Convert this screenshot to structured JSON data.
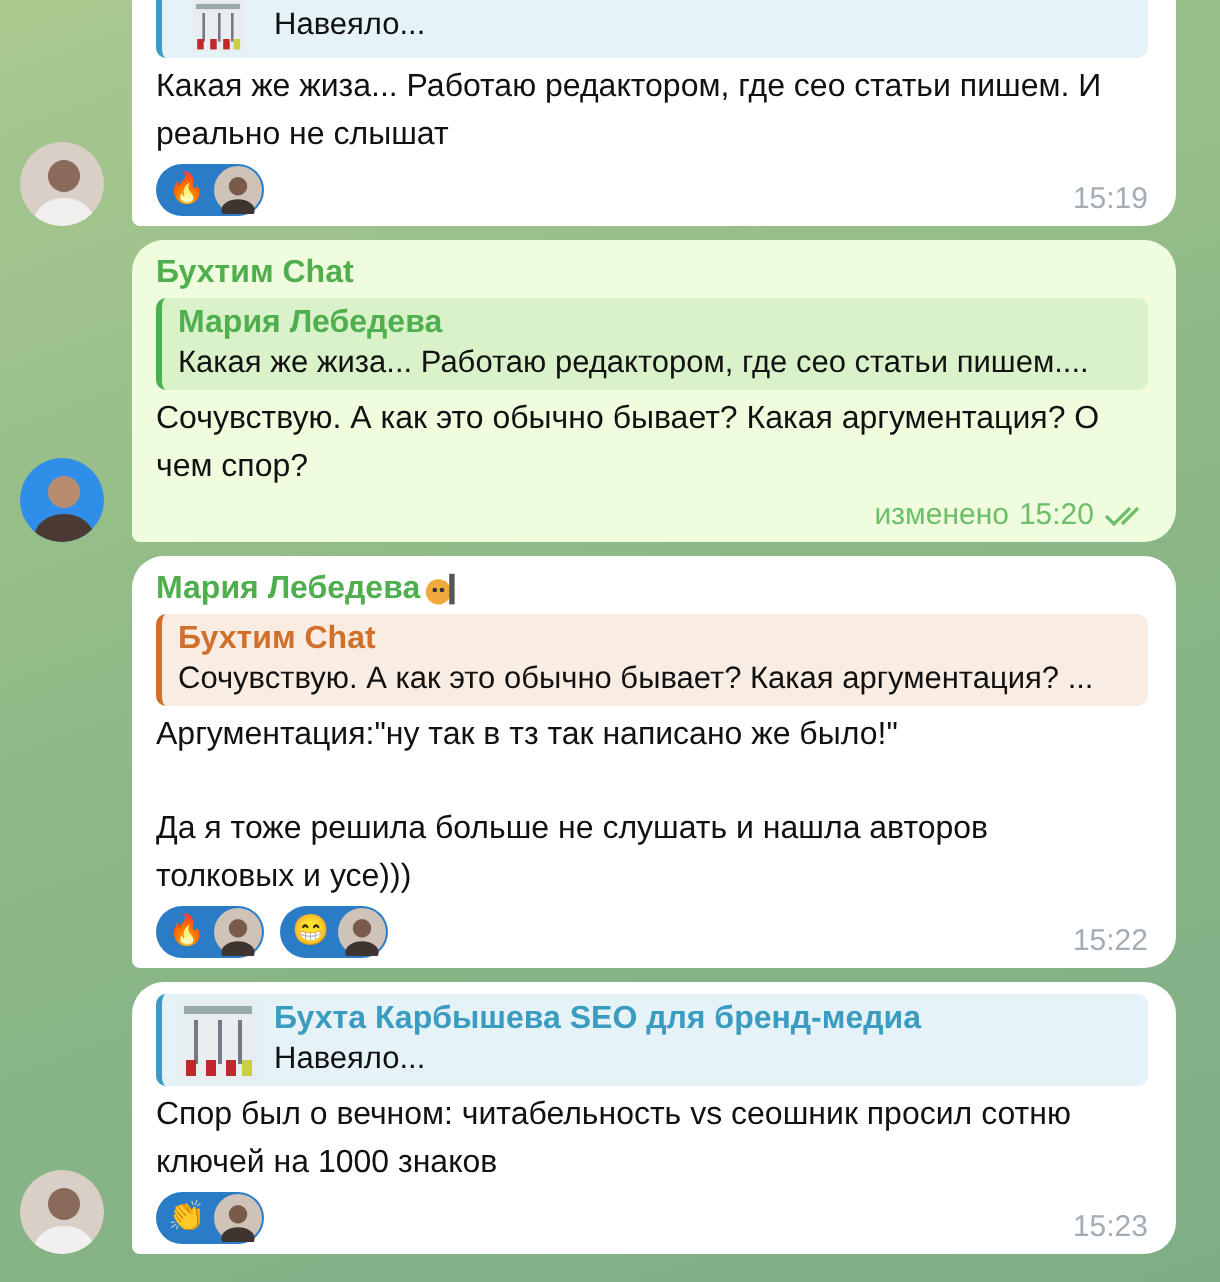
{
  "messages": [
    {
      "kind": "incoming",
      "avatar": true,
      "reply": {
        "text": "Навеяло...",
        "thumbnail": true,
        "color": "#3a9cc0"
      },
      "paragraphs": [
        "Какая же жиза... Работаю редактором, где сео статьи пишем. И реально не слышат"
      ],
      "reactions": [
        {
          "emoji": "🔥"
        }
      ],
      "time": "15:19"
    },
    {
      "kind": "outgoing",
      "avatar": true,
      "sender": {
        "name": "Бухтим Chat",
        "color": "#4fae4e"
      },
      "reply": {
        "title": "Мария Лебедева",
        "text": "Какая же жиза... Работаю редактором, где сео статьи пишем....",
        "color": "#4fae4e"
      },
      "paragraphs": [
        "Сочувствую. А как это обычно бывает? Какая аргументация? О чем спор?"
      ],
      "edited": "изменено",
      "time": "15:20",
      "read": true
    },
    {
      "kind": "incoming",
      "avatar": false,
      "sender": {
        "name": "Мария Лебедева",
        "color": "#4fae4e",
        "badge": true
      },
      "reply": {
        "title": "Бухтим Chat",
        "text": "Сочувствую. А как это обычно бывает? Какая аргументация? ...",
        "color": "#d0702a"
      },
      "paragraphs": [
        "Аргументация:\"ну так в тз так написано же было!\"",
        "Да я тоже решила больше не слушать и нашла авторов толковых и усе)))"
      ],
      "reactions": [
        {
          "emoji": "🔥"
        },
        {
          "emoji": "😁"
        }
      ],
      "time": "15:22"
    },
    {
      "kind": "incoming",
      "avatar": true,
      "reply": {
        "title": "Бухта Карбышева SEO для бренд-медиа",
        "text": "Навеяло...",
        "thumbnail": true,
        "color": "#3a9cc0"
      },
      "paragraphs": [
        "Спор был о вечном: читабельность vs сеошник просил сотню ключей на 1000 знаков"
      ],
      "reactions": [
        {
          "emoji": "👏"
        }
      ],
      "time": "15:23"
    }
  ]
}
